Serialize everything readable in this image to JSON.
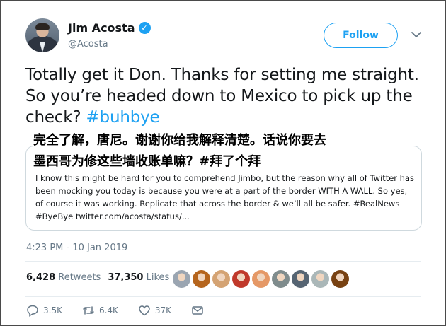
{
  "author": {
    "name": "Jim Acosta",
    "handle": "@Acosta",
    "verified_glyph": "✓"
  },
  "follow_label": "Follow",
  "tweet": {
    "text": "Totally get it Don. Thanks for setting me straight. So you’re headed down to Mexico to pick up the check? ",
    "hashtag": "#buhbye"
  },
  "translation_overlay": {
    "line1": "完全了解，唐尼。谢谢你给我解释清楚。话说你要去",
    "line2": "墨西哥为修这些墙收账单嘛？#拜了个拜"
  },
  "quoted_tweet": {
    "text": "I know this might be hard for you to comprehend Jimbo, but the reason why all of Twitter has been mocking you today is because you were at a part of the border WITH A WALL. So yes, of course it was working. Replicate that across the border & we’ll all be safer. #RealNews #ByeBye twitter.com/acosta/status/..."
  },
  "timestamp": "4:23 PM - 10 Jan 2019",
  "stats": {
    "retweets_count": "6,428",
    "retweets_label": "Retweets",
    "likes_count": "37,350",
    "likes_label": "Likes"
  },
  "liker_avatars": [
    {
      "color": "#9aa5b1"
    },
    {
      "color": "#b5651d"
    },
    {
      "color": "#d4a373"
    },
    {
      "color": "#c0392b"
    },
    {
      "color": "#e59866"
    },
    {
      "color": "#7f8c8d"
    },
    {
      "color": "#566573"
    },
    {
      "color": "#aab7b8"
    },
    {
      "color": "#784212"
    }
  ],
  "actions": {
    "reply_count": "3.5K",
    "retweet_count": "6.4K",
    "like_count": "37K"
  },
  "colors": {
    "accent": "#1da1f2",
    "text": "#14171a",
    "secondary": "#657786"
  }
}
